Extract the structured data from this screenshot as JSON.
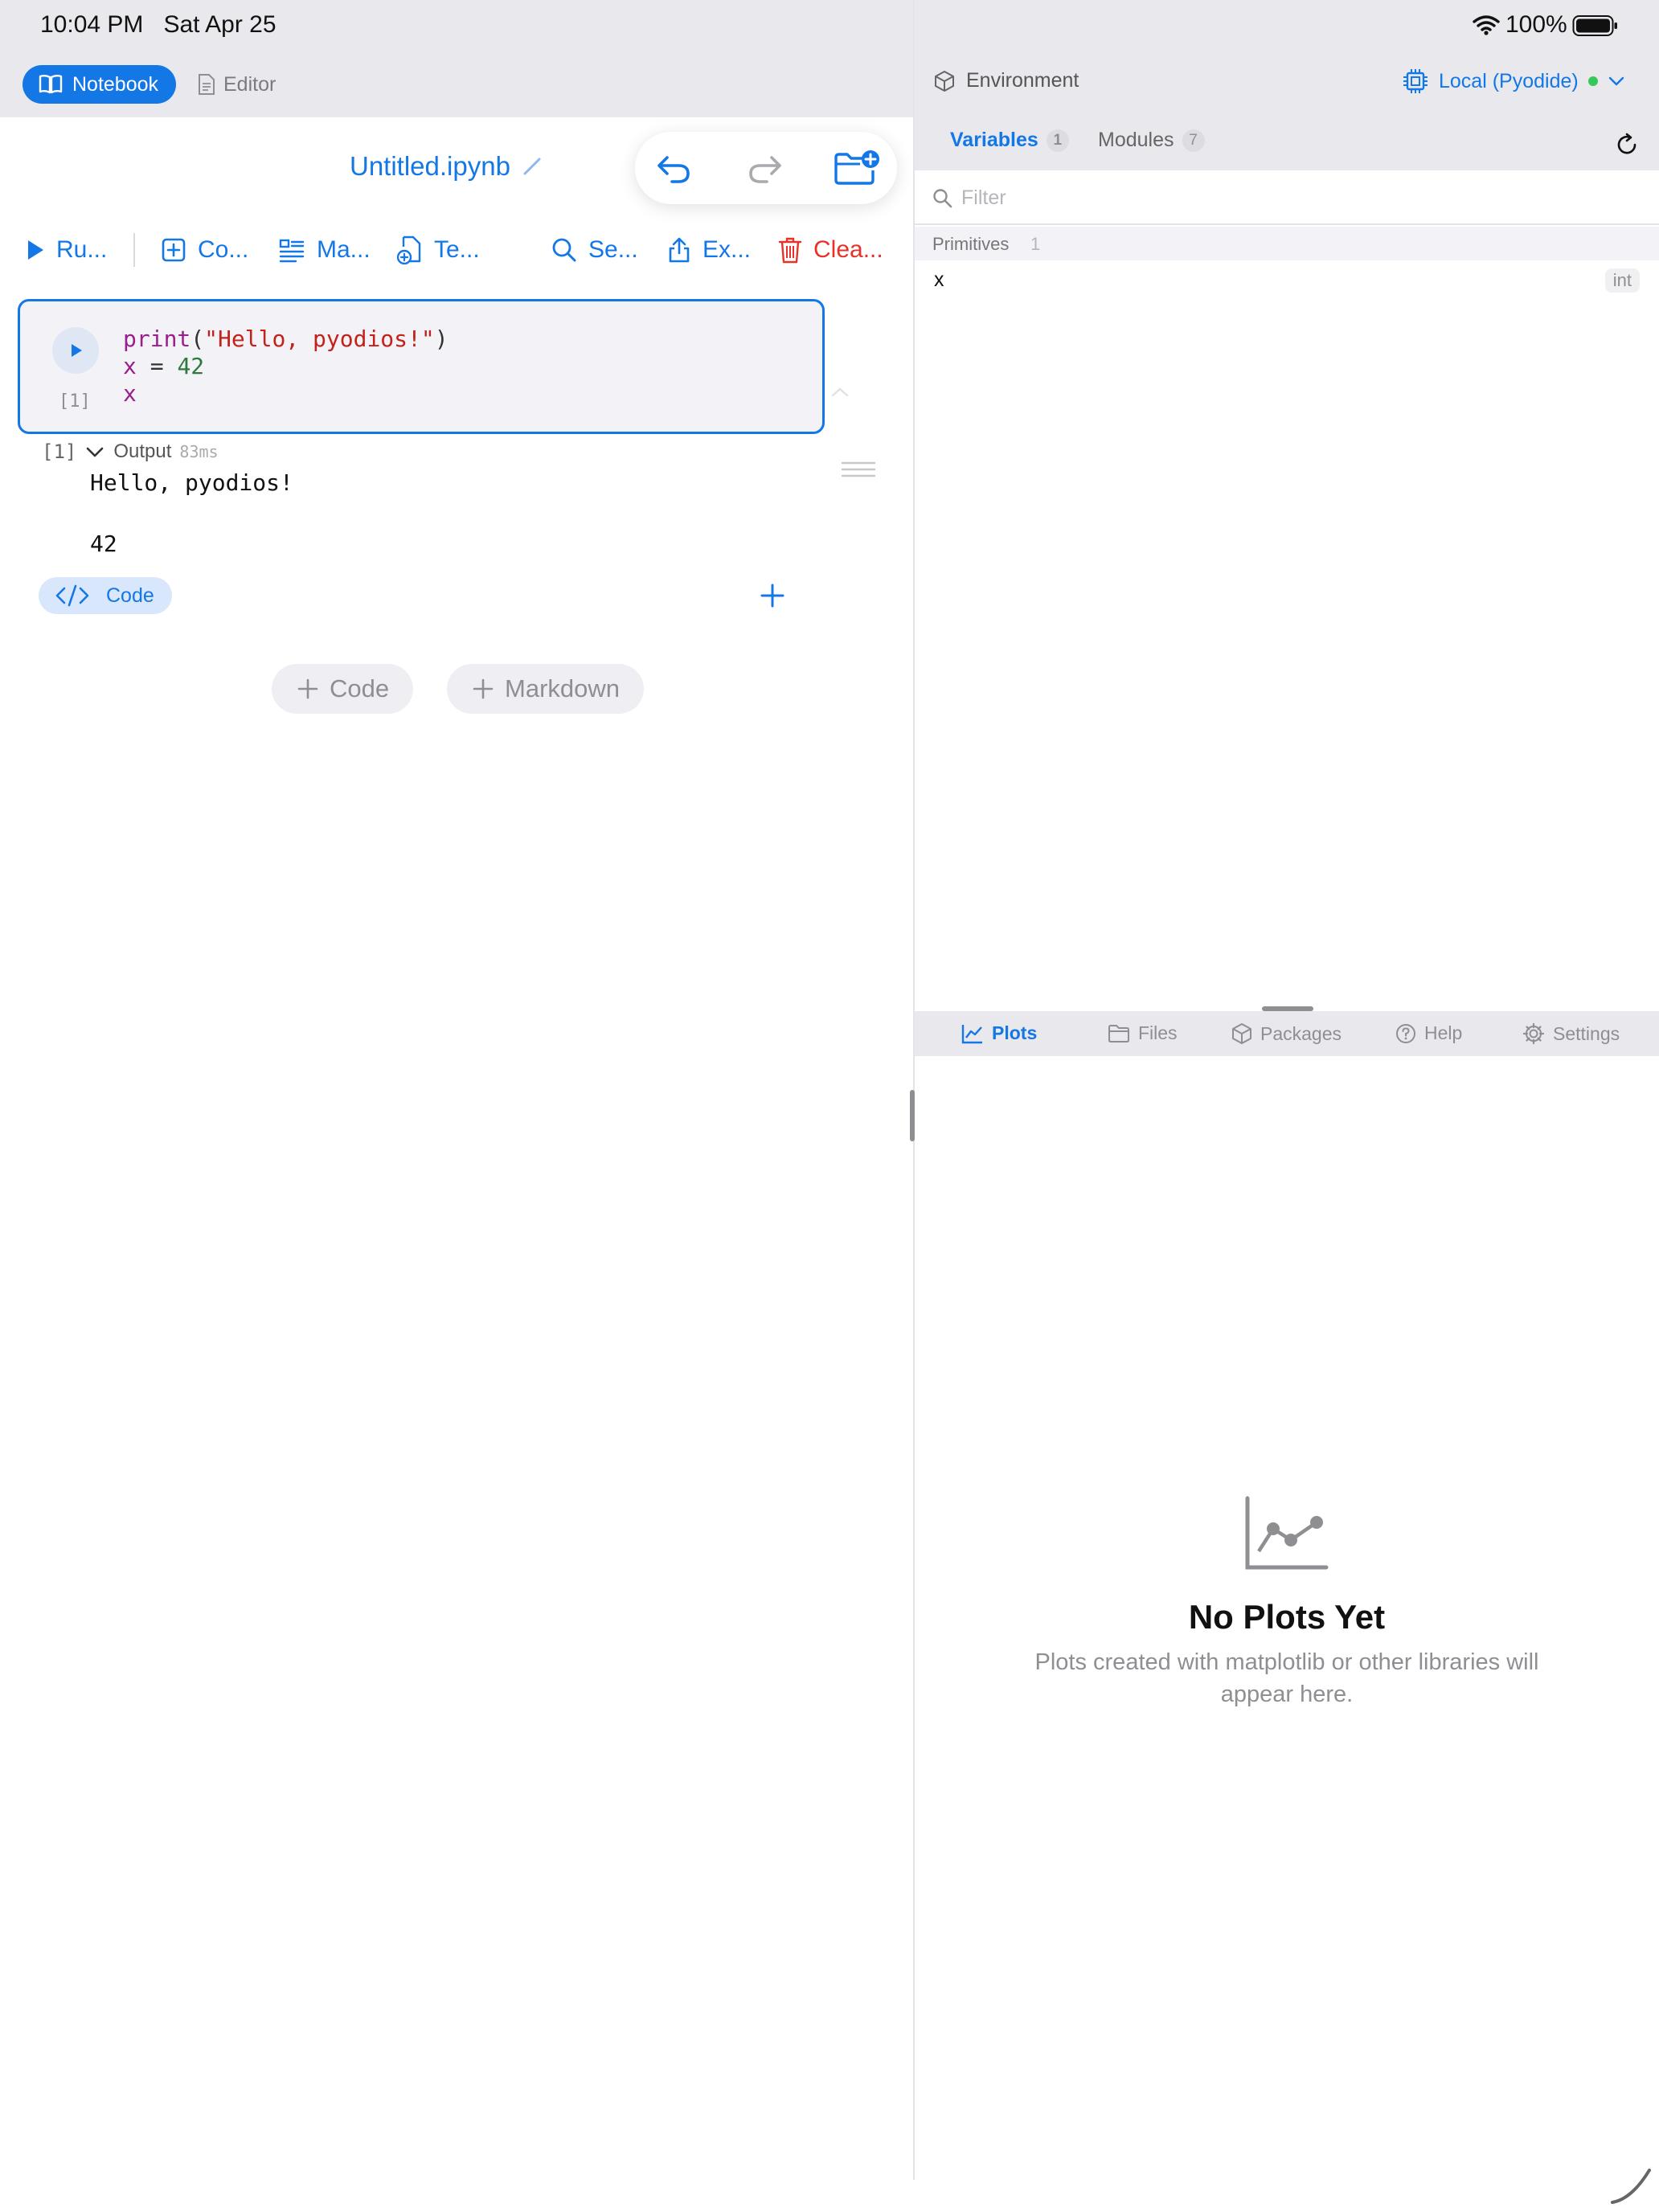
{
  "status": {
    "time": "10:04 PM",
    "date": "Sat Apr 25",
    "battery": "100%"
  },
  "modes": {
    "notebook": "Notebook",
    "editor": "Editor"
  },
  "document": {
    "title": "Untitled.ipynb"
  },
  "toolbar": {
    "run": "Ru...",
    "code": "Co...",
    "markdown": "Ma...",
    "template": "Te...",
    "search": "Se...",
    "export": "Ex...",
    "clear": "Clea..."
  },
  "cell": {
    "execution_count": "[1]",
    "code": {
      "l1_fn": "print",
      "l1_open": "(",
      "l1_str": "\"Hello, pyodios!\"",
      "l1_close": ")",
      "l2_var": "x",
      "l2_op": " = ",
      "l2_num": "42",
      "l3_var": "x"
    },
    "output_count": "[1]",
    "output_label": "Output",
    "output_time": "83ms",
    "output_lines": [
      "Hello, pyodios!",
      "42"
    ],
    "type_chip": "Code"
  },
  "add_buttons": {
    "code": "Code",
    "markdown": "Markdown"
  },
  "environment": {
    "label": "Environment",
    "kernel": "Local (Pyodide)",
    "tabs": [
      {
        "label": "Variables",
        "count": "1"
      },
      {
        "label": "Modules",
        "count": "7"
      }
    ],
    "filter_placeholder": "Filter",
    "section": {
      "label": "Primitives",
      "count": "1"
    },
    "variables": [
      {
        "name": "x",
        "type": "int"
      }
    ]
  },
  "bottom_tabs": [
    "Plots",
    "Files",
    "Packages",
    "Help",
    "Settings"
  ],
  "plots_empty": {
    "title": "No Plots Yet",
    "description": "Plots created with matplotlib or other libraries will appear here."
  },
  "colors": {
    "accent": "#1477e6",
    "destructive": "#e5332a",
    "kernel_status": "#34c759"
  }
}
